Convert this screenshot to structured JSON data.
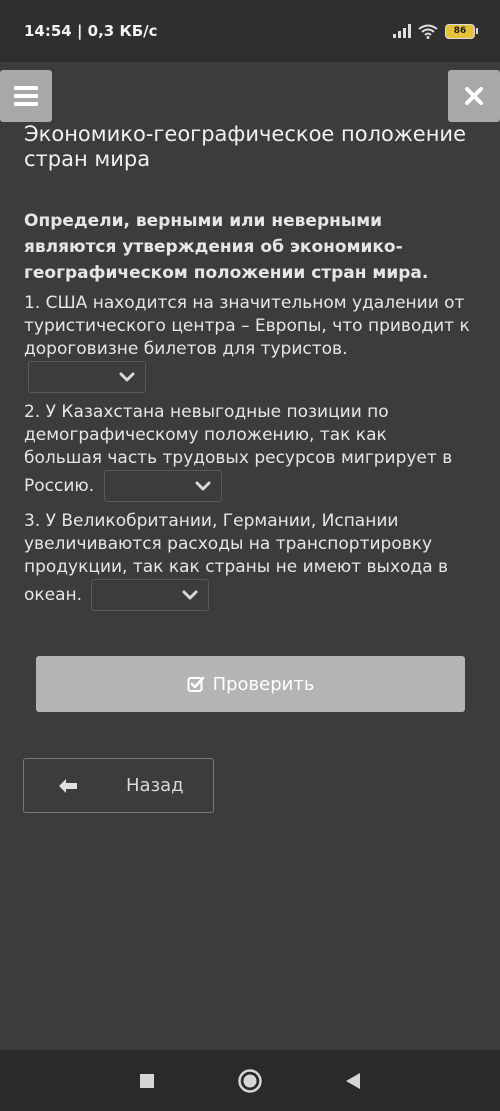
{
  "status_bar": {
    "time_speed": "14:54 | 0,3 КБ/с",
    "battery": "86"
  },
  "page": {
    "title": "Экономико-географическое положение стран мира"
  },
  "task": {
    "instruction": "Определи, верными или неверными являются утверждения об экономико-географическом положении стран мира.",
    "items": [
      {
        "text": "1. США находится на значительном удалении от туристического центра – Европы, что приводит к дороговизне билетов для туристов.",
        "selected": ""
      },
      {
        "text": "2. У Казахстана невыгодные позиции по демографическому положению, так как большая часть трудовых ресурсов мигрирует в Россию.",
        "selected": ""
      },
      {
        "text": "3. У Великобритании, Германии, Испании увеличиваются расходы на транспортировку продукции, так как страны не имеют выхода в океан.",
        "selected": ""
      }
    ]
  },
  "buttons": {
    "check_label": "Проверить",
    "back_label": "Назад"
  },
  "icons": {
    "menu": "hamburger-icon",
    "close": "close-icon",
    "dropdown": "chevron-down-icon",
    "check": "checkbox-check-icon",
    "back": "arrow-left-icon"
  },
  "colors": {
    "background": "#3c3c3c",
    "check_button": "#b4b4b4",
    "top_buttons": "#a8a8a8",
    "battery": "#e6c13a"
  }
}
